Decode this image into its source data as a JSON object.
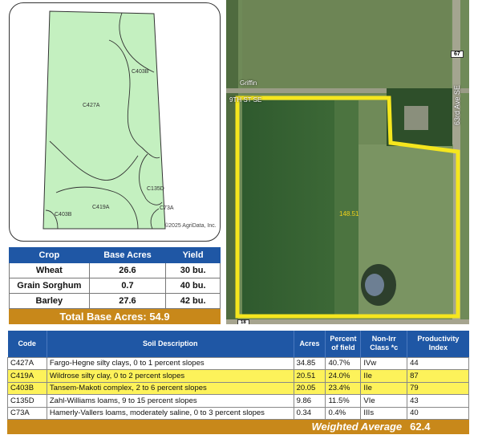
{
  "soil_map": {
    "units": [
      "C403B",
      "C427A",
      "C135D",
      "C419A",
      "C403B",
      "C73A"
    ],
    "credit": "©2025 AgriData, Inc."
  },
  "aerial_map": {
    "place_label": "Griffin",
    "road_label_left": "9TH ST SE",
    "highway_badge": "67",
    "road_name": "63rd Ave SE",
    "bottom_badge": "18",
    "field_acres": "148.51"
  },
  "crop_table": {
    "headers": [
      "Crop",
      "Base Acres",
      "Yield"
    ],
    "rows": [
      {
        "crop": "Wheat",
        "base_acres": "26.6",
        "yield": "30 bu."
      },
      {
        "crop": "Grain Sorghum",
        "base_acres": "0.7",
        "yield": "40 bu."
      },
      {
        "crop": "Barley",
        "base_acres": "27.6",
        "yield": "42 bu."
      }
    ],
    "total": "Total Base Acres: 54.9"
  },
  "soil_table": {
    "headers": {
      "code": "Code",
      "description": "Soil Description",
      "acres": "Acres",
      "percent_1": "Percent",
      "percent_2": "of field",
      "class_1": "Non-Irr",
      "class_2": "Class *c",
      "index_1": "Productivity",
      "index_2": "Index"
    },
    "rows": [
      {
        "code": "C427A",
        "description": "Fargo-Hegne silty clays, 0 to 1 percent slopes",
        "acres": "34.85",
        "percent": "40.7%",
        "class": "IVw",
        "index": "44"
      },
      {
        "code": "C419A",
        "description": "Wildrose silty clay, 0 to 2 percent slopes",
        "acres": "20.51",
        "percent": "24.0%",
        "class": "IIe",
        "index": "87"
      },
      {
        "code": "C403B",
        "description": "Tansem-Makoti complex, 2 to 6 percent slopes",
        "acres": "20.05",
        "percent": "23.4%",
        "class": "IIe",
        "index": "79"
      },
      {
        "code": "C135D",
        "description": "Zahl-Williams loams, 9 to 15 percent slopes",
        "acres": "9.86",
        "percent": "11.5%",
        "class": "VIe",
        "index": "43"
      },
      {
        "code": "C73A",
        "description": "Hamerly-Vallers loams, moderately saline, 0 to 3 percent slopes",
        "acres": "0.34",
        "percent": "0.4%",
        "class": "IIIs",
        "index": "40"
      }
    ],
    "weighted_label": "Weighted Average",
    "weighted_value": "62.4"
  },
  "colors": {
    "table_header": "#1f57a5",
    "total_bar": "#c8881a",
    "highlight": "#fdf25a",
    "soil_fill": "#c4f0c0",
    "field_outline": "#f5e61e"
  }
}
